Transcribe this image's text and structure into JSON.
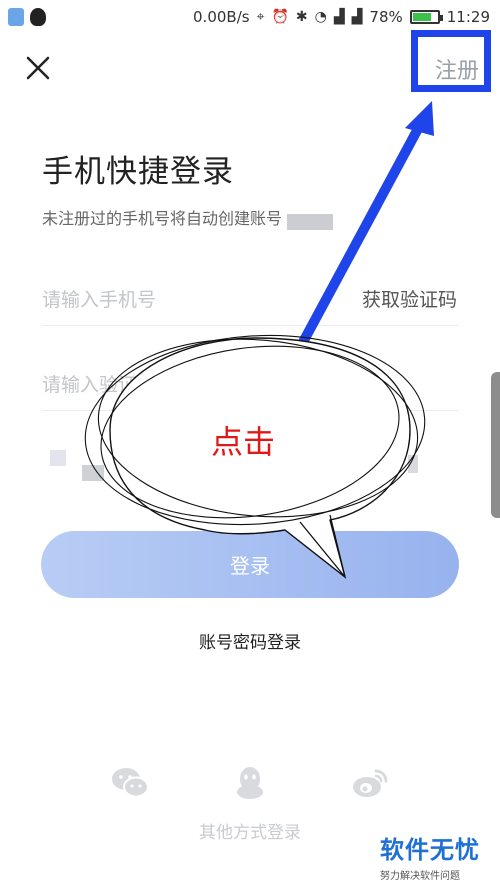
{
  "status_bar": {
    "speed": "0.00B/s",
    "battery": "78%",
    "battery_level": 0.78,
    "time": "11:29",
    "icons": [
      "location-icon",
      "alarm-icon",
      "bluetooth-icon",
      "wifi-icon",
      "signal-icon",
      "signal-icon"
    ]
  },
  "header": {
    "register_label": "注册"
  },
  "main": {
    "title": "手机快捷登录",
    "subtitle": "未注册过的手机号将自动创建账号",
    "phone_placeholder": "请输入手机号",
    "get_code_label": "获取验证码",
    "code_placeholder": "请输入验证码",
    "login_label": "登录",
    "account_login_label": "账号密码登录"
  },
  "other_login": {
    "label": "其他方式登录",
    "icons": [
      "wechat-icon",
      "qq-icon",
      "weibo-icon"
    ]
  },
  "annotation": {
    "bubble_text": "点击",
    "accent_color": "#1e44ea",
    "text_color": "#e01818"
  },
  "watermark": {
    "main": "软件无忧",
    "sub": "努力解决软件问题"
  },
  "colors": {
    "login_button_start": "#b8cdf5",
    "login_button_end": "#97b2ee",
    "placeholder": "#c2c5ca"
  }
}
